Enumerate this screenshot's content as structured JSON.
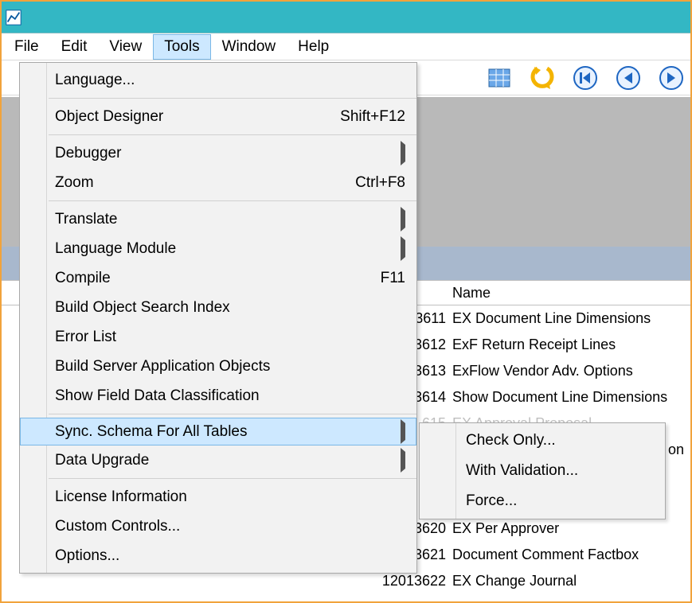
{
  "menubar": {
    "file": "File",
    "edit": "Edit",
    "view": "View",
    "tools": "Tools",
    "window": "Window",
    "help": "Help"
  },
  "tools_menu": {
    "language": "Language...",
    "object_designer": "Object Designer",
    "object_designer_accel": "Shift+F12",
    "debugger": "Debugger",
    "zoom": "Zoom",
    "zoom_accel": "Ctrl+F8",
    "translate": "Translate",
    "language_module": "Language Module",
    "compile": "Compile",
    "compile_accel": "F11",
    "build_index": "Build Object Search Index",
    "error_list": "Error List",
    "build_server": "Build Server Application Objects",
    "show_field": "Show Field Data Classification",
    "sync_schema": "Sync. Schema For All Tables",
    "data_upgrade": "Data Upgrade",
    "license_info": "License Information",
    "custom_controls": "Custom Controls...",
    "options": "Options..."
  },
  "sync_submenu": {
    "check_only": "Check Only...",
    "with_validation": "With Validation...",
    "force": "Force..."
  },
  "table": {
    "name_header": "Name",
    "rows": {
      "r0_id": "3611",
      "r0_name": "EX Document Line Dimensions",
      "r1_id": "3612",
      "r1_name": "ExF Return Receipt Lines",
      "r2_id": "3613",
      "r2_name": "ExFlow Vendor Adv. Options",
      "r3_id": "3614",
      "r3_name": "Show Document Line Dimensions",
      "r4_id_partial": "615",
      "r4_name_partial": "EX Approval Proposal",
      "r5_name_tail": "on",
      "r6_id": "3620",
      "r6_name": "EX Per Approver",
      "r7_id": "3621",
      "r7_name": "Document Comment Factbox",
      "r8_id": "12013622",
      "r8_name": "EX Change Journal"
    }
  }
}
